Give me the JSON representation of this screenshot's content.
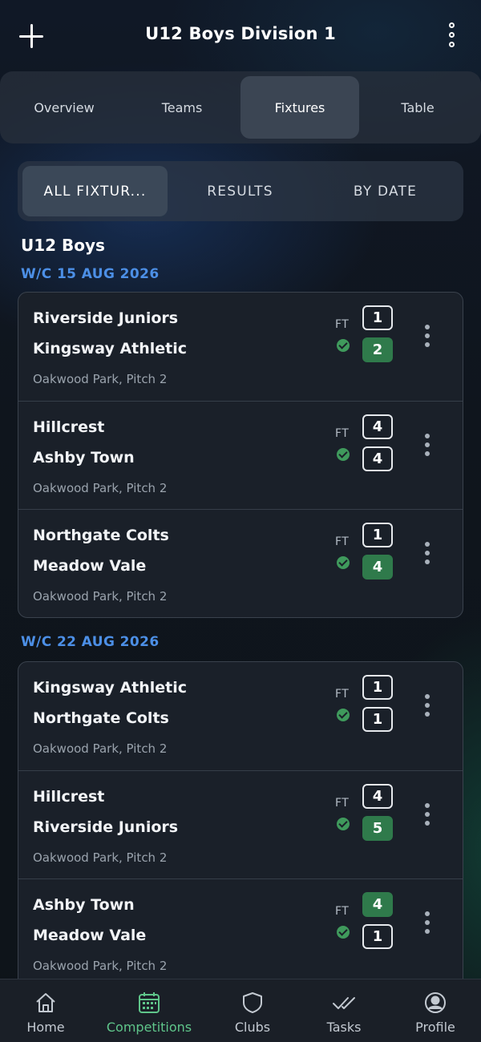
{
  "header": {
    "title": "U12 Boys Division 1",
    "add_icon": "plus-icon",
    "more_icon": "more-vertical-icon"
  },
  "tabs": [
    {
      "label": "Overview",
      "active": false
    },
    {
      "label": "Teams",
      "active": false
    },
    {
      "label": "Fixtures",
      "active": true
    },
    {
      "label": "Table",
      "active": false
    }
  ],
  "subtabs": [
    {
      "label": "ALL FIXTUR...",
      "active": true
    },
    {
      "label": "RESULTS",
      "active": false
    },
    {
      "label": "BY DATE",
      "active": false
    }
  ],
  "group_title": "U12 Boys",
  "weeks": [
    {
      "label": "W/C 15 AUG 2026",
      "fixtures": [
        {
          "home": "Riverside Juniors",
          "away": "Kingsway Athletic",
          "venue": "Oakwood Park, Pitch 2",
          "status": "FT",
          "home_score": "1",
          "away_score": "2",
          "winner": "away"
        },
        {
          "home": "Hillcrest",
          "away": "Ashby Town",
          "venue": "Oakwood Park, Pitch 2",
          "status": "FT",
          "home_score": "4",
          "away_score": "4",
          "winner": "draw"
        },
        {
          "home": "Northgate Colts",
          "away": "Meadow Vale",
          "venue": "Oakwood Park, Pitch 2",
          "status": "FT",
          "home_score": "1",
          "away_score": "4",
          "winner": "away"
        }
      ]
    },
    {
      "label": "W/C 22 AUG 2026",
      "fixtures": [
        {
          "home": "Kingsway Athletic",
          "away": "Northgate Colts",
          "venue": "Oakwood Park, Pitch 2",
          "status": "FT",
          "home_score": "1",
          "away_score": "1",
          "winner": "draw"
        },
        {
          "home": "Hillcrest",
          "away": "Riverside Juniors",
          "venue": "Oakwood Park, Pitch 2",
          "status": "FT",
          "home_score": "4",
          "away_score": "5",
          "winner": "away"
        },
        {
          "home": "Ashby Town",
          "away": "Meadow Vale",
          "venue": "Oakwood Park, Pitch 2",
          "status": "FT",
          "home_score": "4",
          "away_score": "1",
          "winner": "home"
        }
      ]
    }
  ],
  "bottom_nav": [
    {
      "label": "Home",
      "icon": "home-icon",
      "active": false
    },
    {
      "label": "Competitions",
      "icon": "calendar-icon",
      "active": true
    },
    {
      "label": "Clubs",
      "icon": "shield-icon",
      "active": false
    },
    {
      "label": "Tasks",
      "icon": "checks-icon",
      "active": false
    },
    {
      "label": "Profile",
      "icon": "user-circle-icon",
      "active": false
    }
  ],
  "colors": {
    "accent_blue": "#4c8fe6",
    "accent_green": "#5fc58a",
    "winner_badge": "#2f7a4b",
    "card_bg": "#1a2029"
  }
}
